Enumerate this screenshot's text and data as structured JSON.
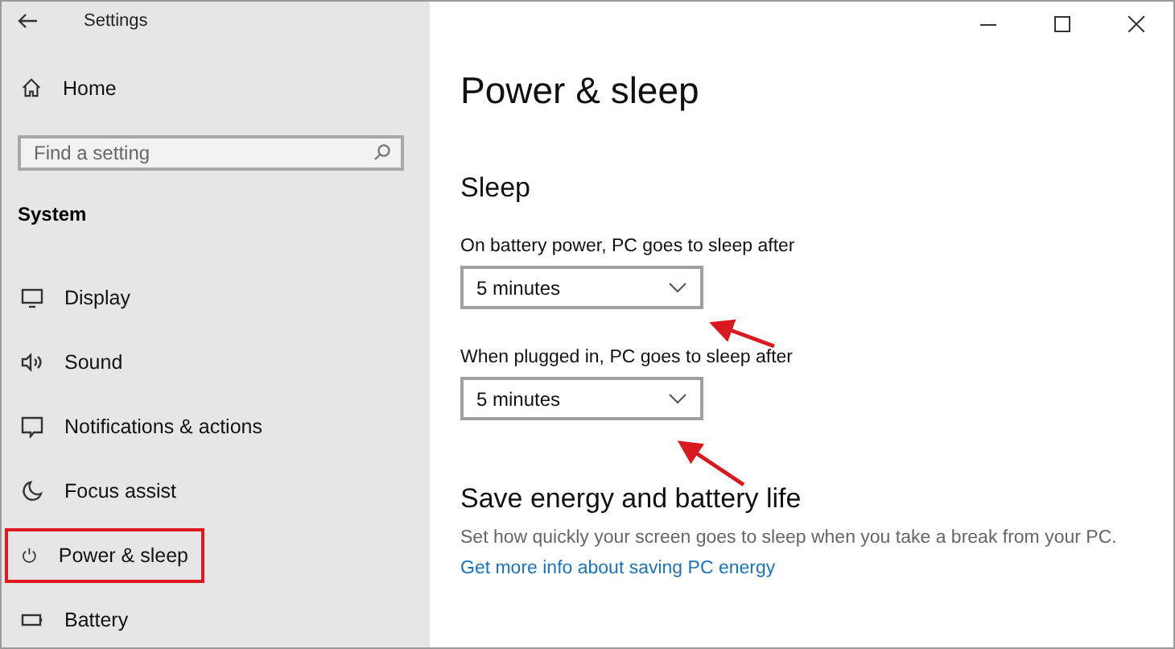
{
  "window": {
    "title": "Settings"
  },
  "sidebar": {
    "home": "Home",
    "search": {
      "placeholder": "Find a setting"
    },
    "section": "System",
    "items": [
      {
        "label": "Display",
        "highlighted": false
      },
      {
        "label": "Sound",
        "highlighted": false
      },
      {
        "label": "Notifications & actions",
        "highlighted": false
      },
      {
        "label": "Focus assist",
        "highlighted": false
      },
      {
        "label": "Power & sleep",
        "highlighted": true
      },
      {
        "label": "Battery",
        "highlighted": false
      }
    ]
  },
  "main": {
    "title": "Power & sleep",
    "sleep": {
      "heading": "Sleep",
      "settings": [
        {
          "label": "On battery power, PC goes to sleep after",
          "value": "5 minutes"
        },
        {
          "label": "When plugged in, PC goes to sleep after",
          "value": "5 minutes"
        }
      ]
    },
    "save": {
      "heading": "Save energy and battery life",
      "text": "Set how quickly your screen goes to sleep when you take a break from your PC.",
      "link": "Get more info about saving PC energy"
    }
  }
}
